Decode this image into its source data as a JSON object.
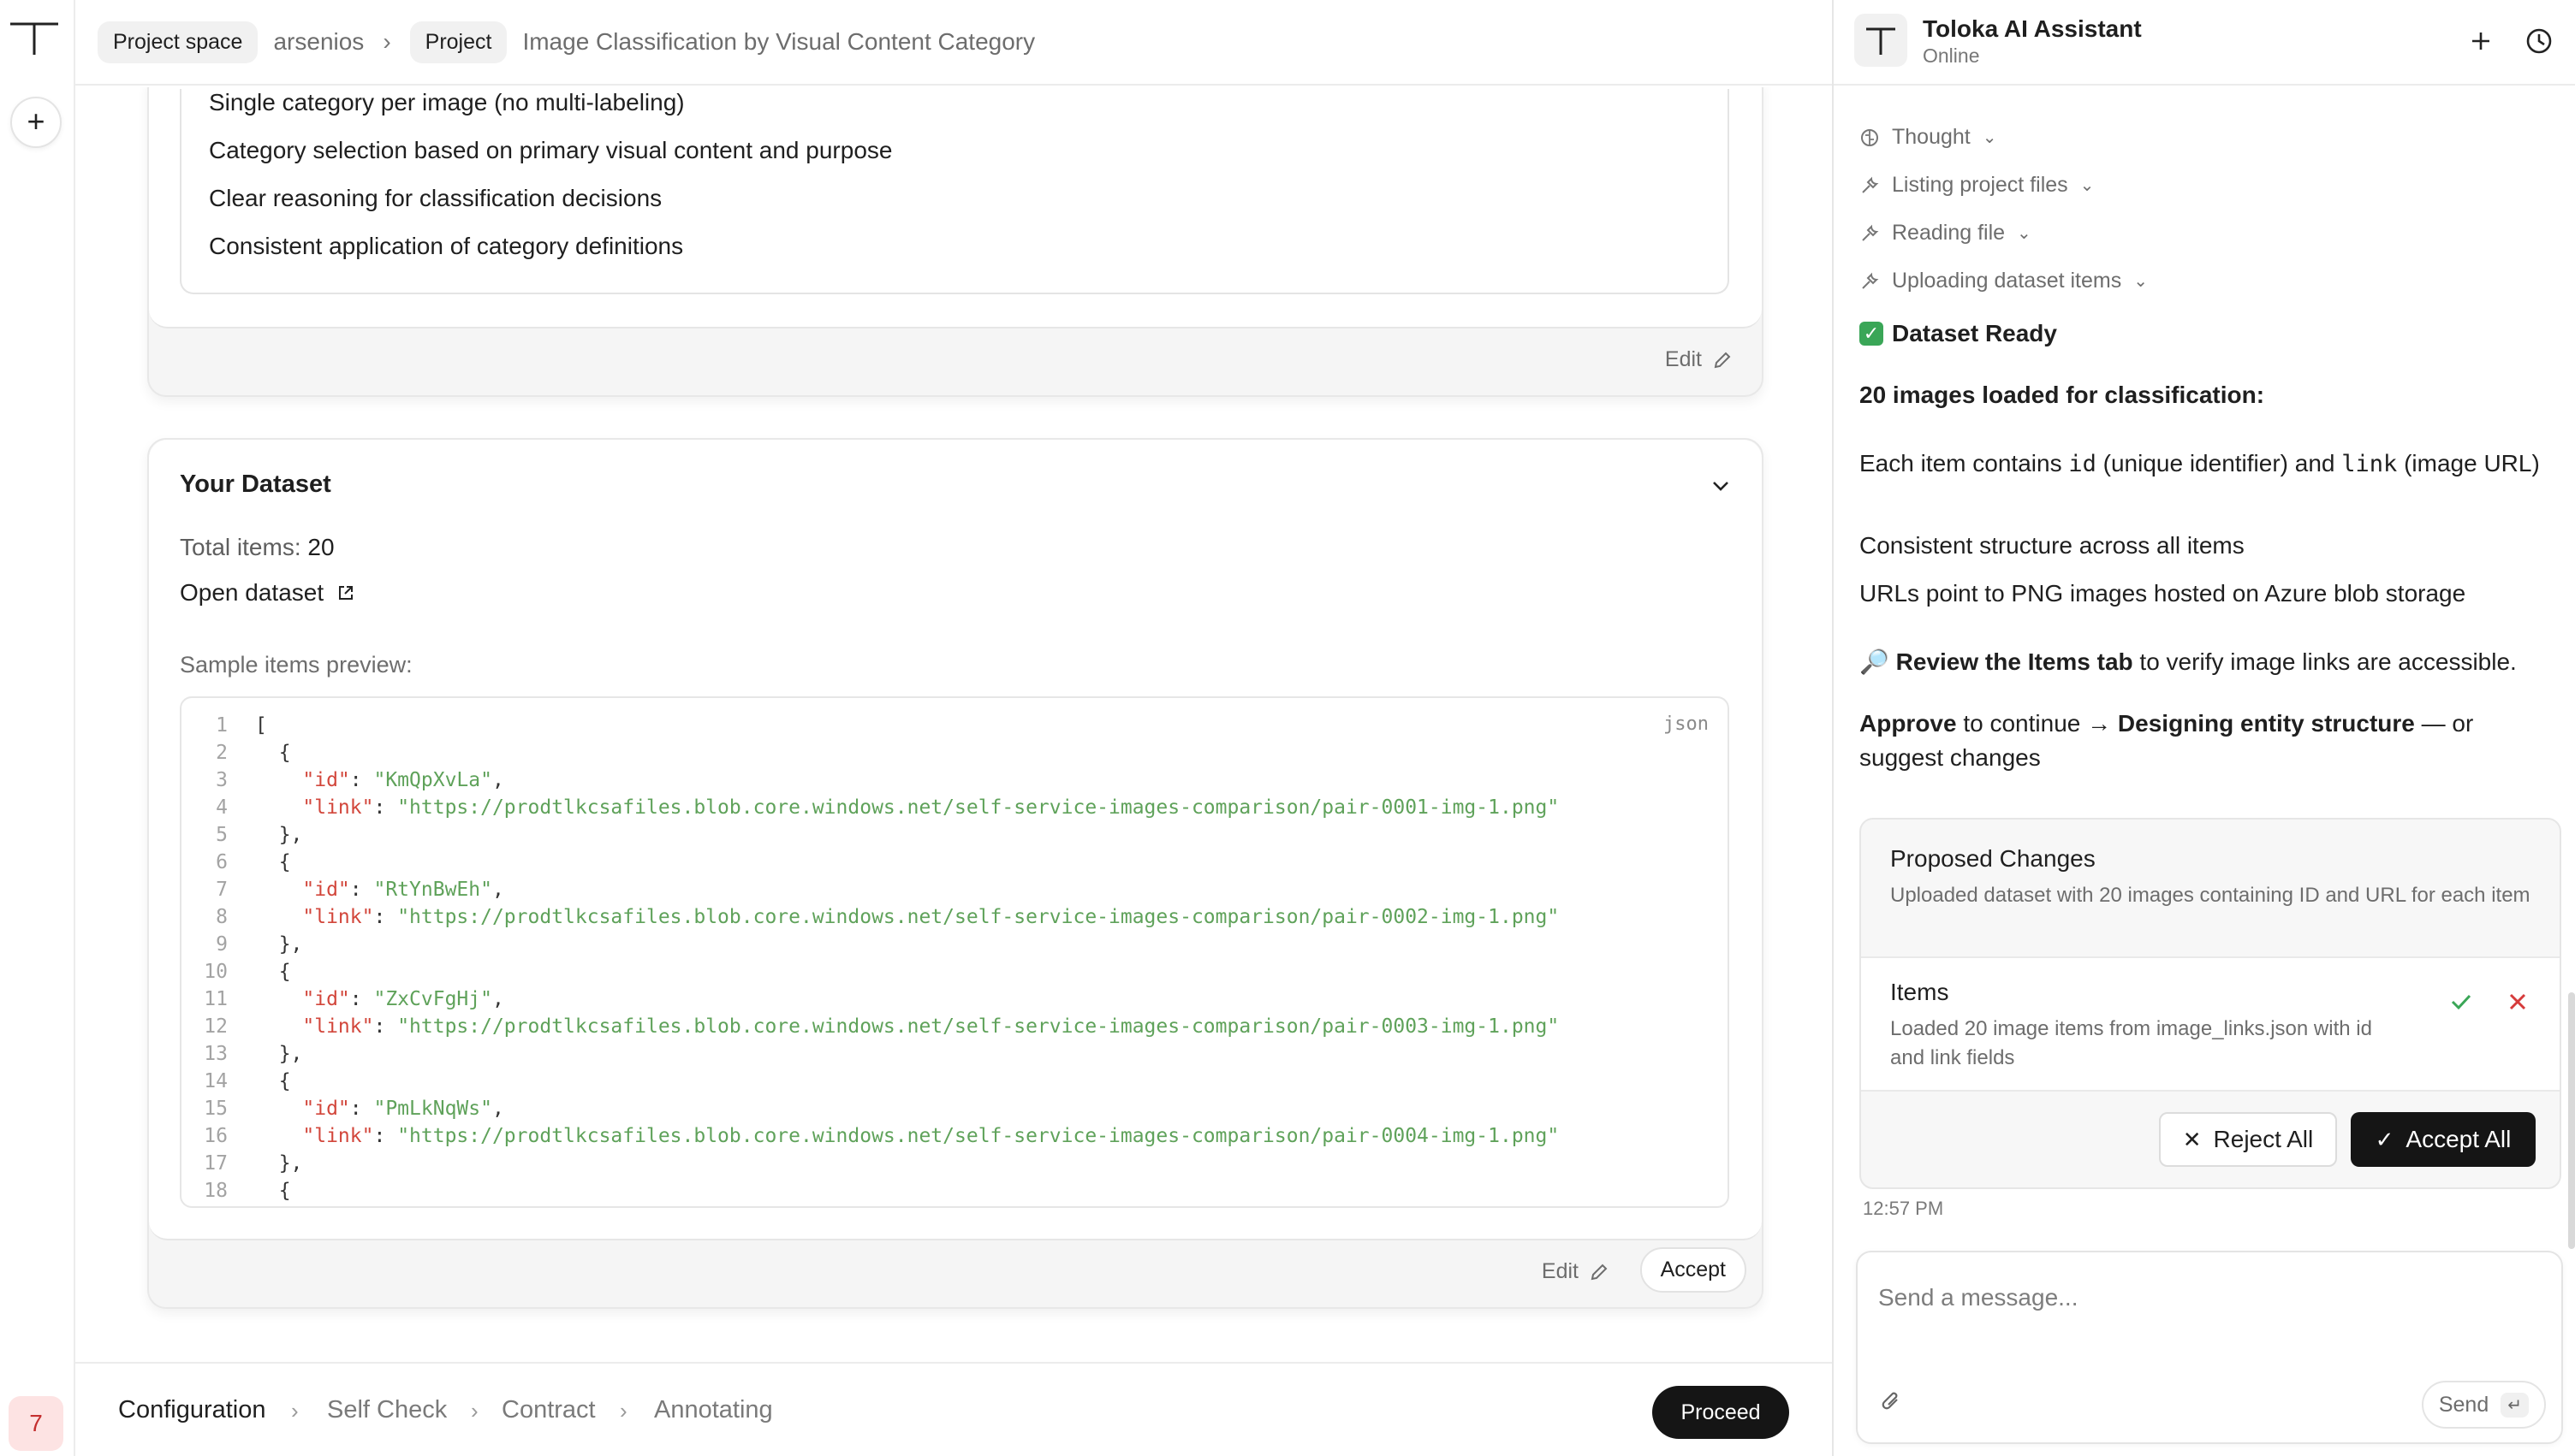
{
  "rail": {
    "badge": "7"
  },
  "breadcrumb": {
    "project_space": "Project space",
    "user": "arsenios",
    "project": "Project",
    "title": "Image Classification by Visual Content Category"
  },
  "criteria": {
    "lines": [
      "Single category per image (no multi-labeling)",
      "Category selection based on primary visual content and purpose",
      "Clear reasoning for classification decisions",
      "Consistent application of category definitions"
    ],
    "edit_label": "Edit"
  },
  "dataset": {
    "title": "Your Dataset",
    "total_label": "Total items:",
    "total_value": "20",
    "open_label": "Open dataset",
    "preview_label": "Sample items preview:",
    "lang": "json",
    "edit_label": "Edit",
    "accept_label": "Accept",
    "items": [
      {
        "id": "KmQpXvLa",
        "link": "https://prodtlkcsafiles.blob.core.windows.net/self-service-images-comparison/pair-0001-img-1.png"
      },
      {
        "id": "RtYnBwEh",
        "link": "https://prodtlkcsafiles.blob.core.windows.net/self-service-images-comparison/pair-0002-img-1.png"
      },
      {
        "id": "ZxCvFgHj",
        "link": "https://prodtlkcsafiles.blob.core.windows.net/self-service-images-comparison/pair-0003-img-1.png"
      },
      {
        "id": "PmLkNqWs",
        "link": "https://prodtlkcsafiles.blob.core.windows.net/self-service-images-comparison/pair-0004-img-1.png"
      }
    ]
  },
  "steps": {
    "items": [
      "Configuration",
      "Self Check",
      "Contract",
      "Annotating"
    ],
    "proceed_label": "Proceed"
  },
  "assistant": {
    "title": "Toloka AI Assistant",
    "status": "Online",
    "tools": [
      "Thought",
      "Listing project files",
      "Reading file",
      "Uploading dataset items"
    ],
    "ready": "Dataset Ready",
    "heading": "20 images loaded for classification:",
    "msg1_a": "Each item contains ",
    "msg1_code1": "id",
    "msg1_b": " (unique identifier) and ",
    "msg1_code2": "link",
    "msg1_c": " (image URL)",
    "msg2": "Consistent structure across all items",
    "msg3": "URLs point to PNG images hosted on Azure blob storage",
    "review_bold": "Review the Items tab",
    "review_rest": " to verify image links are accessible.",
    "approve_bold": "Approve",
    "approve_mid": " to continue → ",
    "approve_bold2": "Designing entity structure",
    "approve_rest": " — or suggest changes",
    "changes_title": "Proposed Changes",
    "changes_desc": "Uploaded dataset with 20 images containing ID and URL for each item",
    "item_title": "Items",
    "item_desc": "Loaded 20 image items from image_links.json with id and link fields",
    "reject_all": "Reject All",
    "accept_all": "Accept All",
    "time": "12:57 PM",
    "composer_placeholder": "Send a message...",
    "send_label": "Send"
  },
  "colors": {
    "accent_dark": "#151515",
    "accept_green": "#3aa657",
    "reject_red": "#d63b3b",
    "json_key": "#d2463b",
    "json_string": "#5fa25a"
  }
}
